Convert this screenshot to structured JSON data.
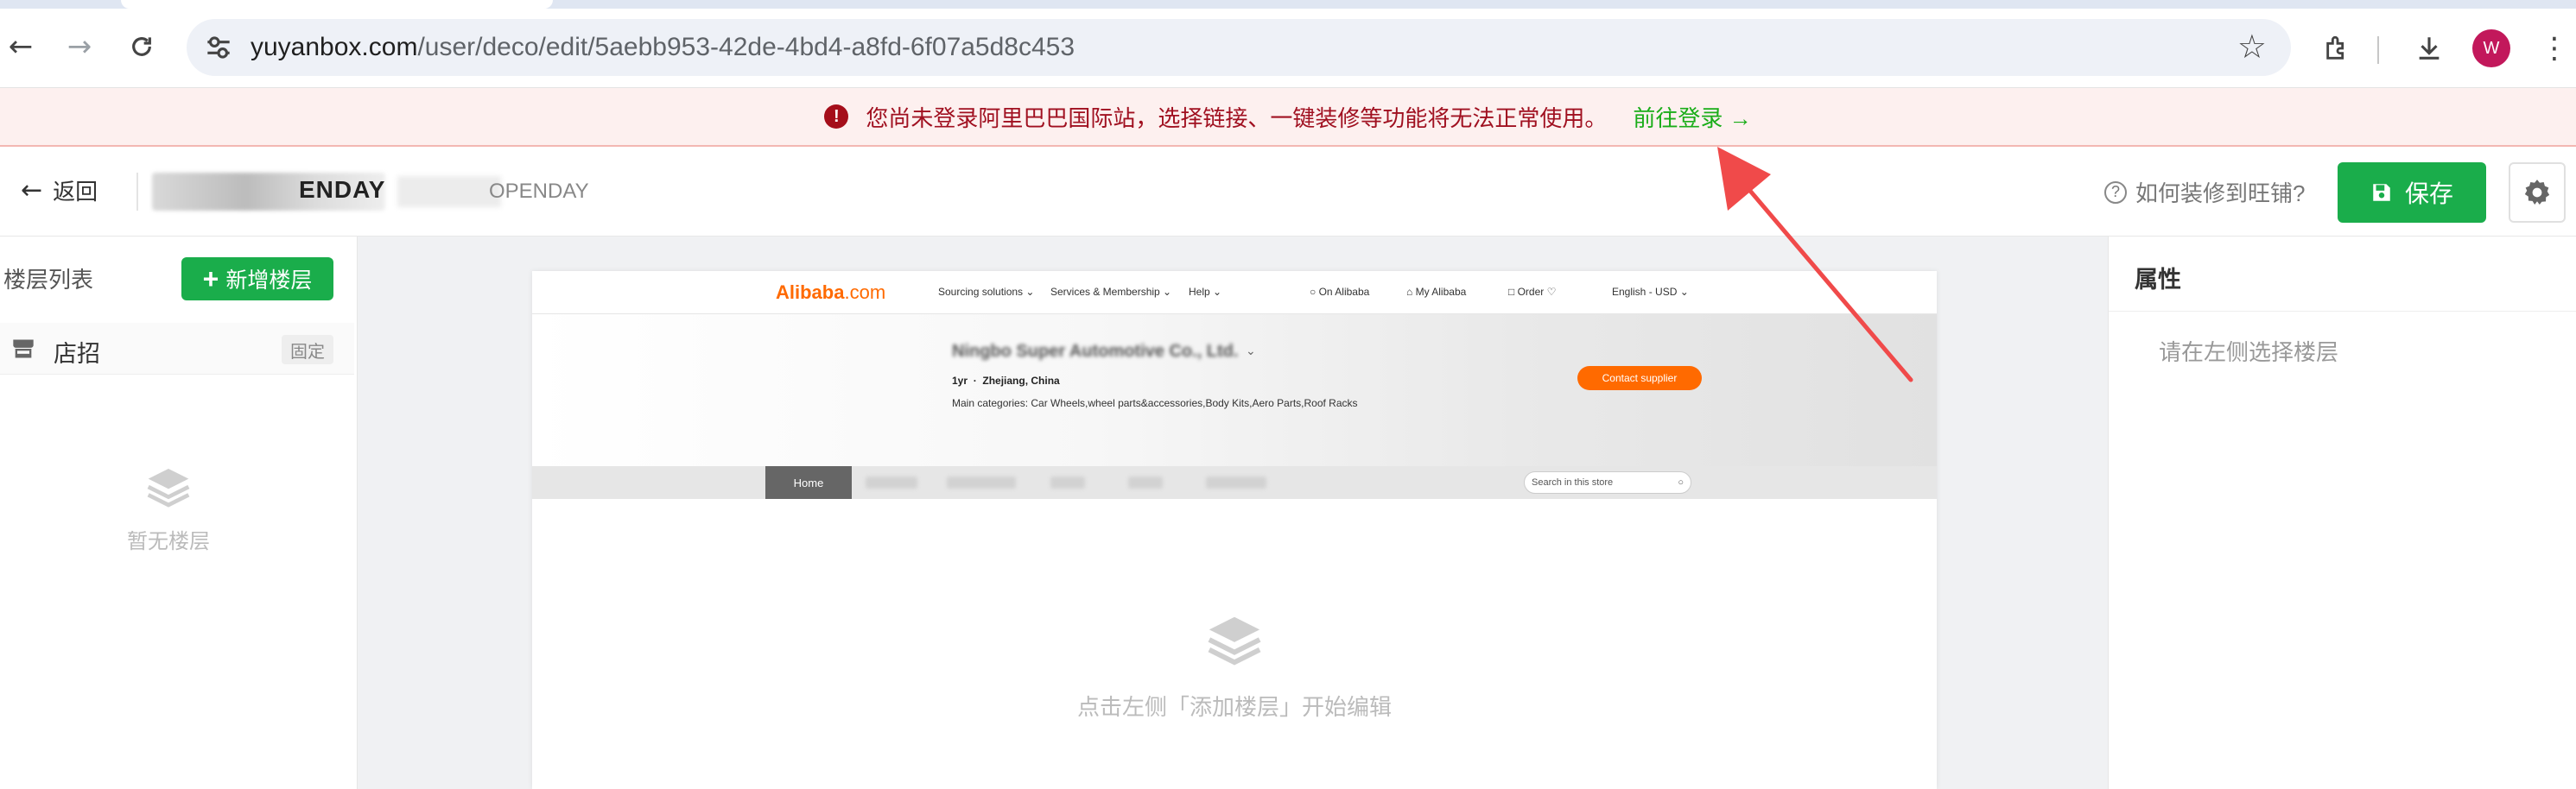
{
  "browser": {
    "url_host": "yuyanbox.com",
    "url_path": "/user/deco/edit/5aebb953-42de-4bd4-a8fd-6f07a5d8c453",
    "avatar_letter": "W"
  },
  "banner": {
    "message": "您尚未登录阿里巴巴国际站，选择链接、一键装修等功能将无法正常使用。",
    "login_link": "前往登录 →"
  },
  "header": {
    "back_label": "返回",
    "shop_name_suffix": "ENDAY",
    "shop_sub_suffix": "OPENDAY",
    "help_label": "如何装修到旺铺?",
    "save_label": "保存"
  },
  "sidebar": {
    "title": "楼层列表",
    "add_button": "新增楼层",
    "fixed_floor": {
      "label": "店招",
      "tag": "固定"
    },
    "empty_text": "暂无楼层"
  },
  "preview": {
    "logo_main": "Alibaba",
    "logo_dom": ".com",
    "nav": {
      "sourcing": "Sourcing solutions",
      "services": "Services & Membership",
      "help": "Help",
      "on_alibaba": "On Alibaba",
      "my_alibaba": "My Alibaba",
      "order": "Order",
      "language": "English - USD"
    },
    "supplier": {
      "name": "Ningbo Super Automotive Co., Ltd.",
      "years": "1yr",
      "location": "Zhejiang, China",
      "categories": "Main categories: Car Wheels,wheel parts&accessories,Body Kits,Aero Parts,Roof Racks",
      "contact_button": "Contact supplier"
    },
    "store_nav": {
      "home": "Home",
      "search_placeholder": "Search in this store"
    },
    "empty_text": "点击左侧「添加楼层」开始编辑"
  },
  "properties": {
    "title": "属性",
    "hint": "请在左侧选择楼层"
  },
  "colors": {
    "accent_green": "#1aad4b",
    "alibaba_orange": "#ff6a00",
    "warning_red": "#a50e1a",
    "annotation_arrow": "#f04a4a"
  }
}
